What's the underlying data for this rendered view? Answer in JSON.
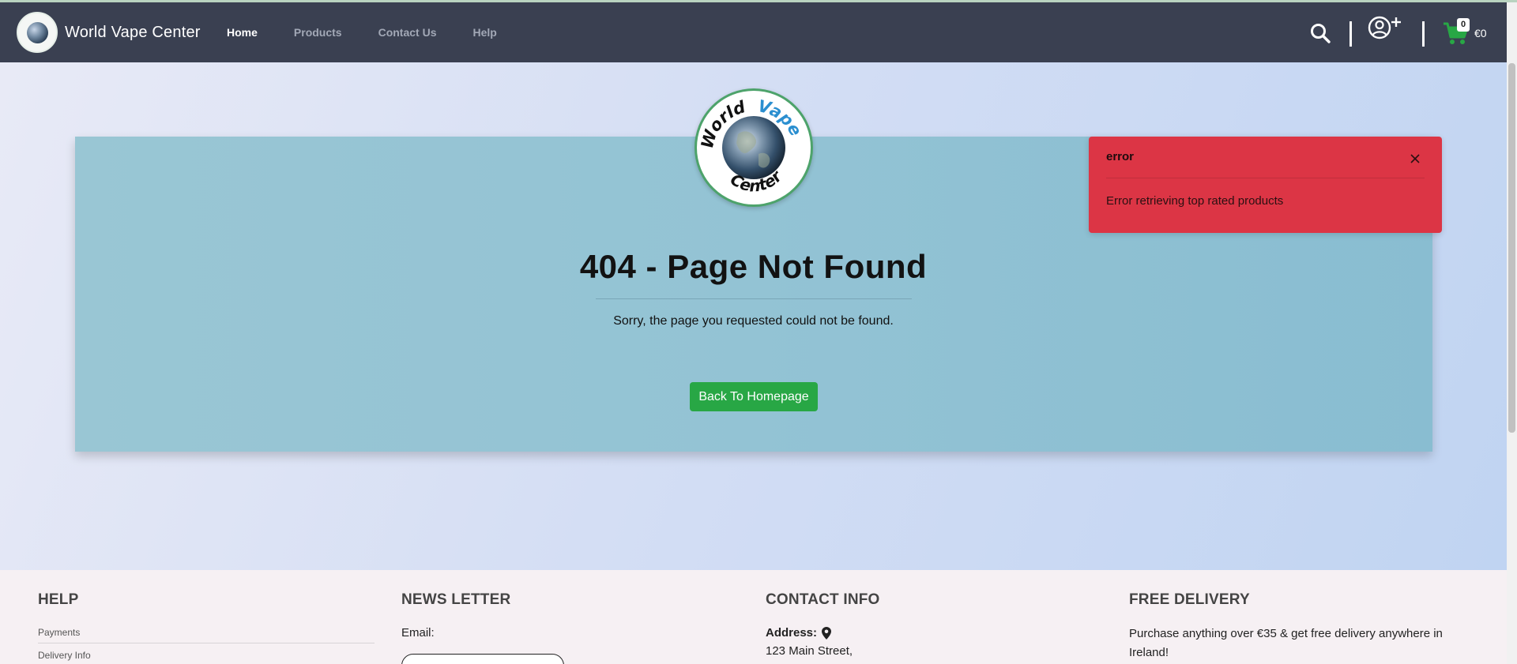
{
  "navbar": {
    "brand_name": "World Vape Center",
    "links": [
      {
        "label": "Home",
        "active": true
      },
      {
        "label": "Products",
        "active": false
      },
      {
        "label": "Contact Us",
        "active": false
      },
      {
        "label": "Help",
        "active": false
      }
    ],
    "cart_count": "0",
    "cart_total": "€0",
    "icons": [
      "search-icon",
      "user-add-icon",
      "cart-icon"
    ]
  },
  "logo": {
    "top_word_1": "World",
    "top_word_2": "Vape",
    "bottom_word": "Center"
  },
  "main": {
    "title": "404 - Page Not Found",
    "subtitle": "Sorry, the page you requested could not be found.",
    "button_label": "Back To Homepage"
  },
  "toast": {
    "title": "error",
    "message": "Error retrieving top rated products"
  },
  "footer": {
    "help": {
      "heading": "HELP",
      "links": [
        "Payments",
        "Delivery Info"
      ]
    },
    "newsletter": {
      "heading": "NEWS LETTER",
      "email_label": "Email:"
    },
    "contact": {
      "heading": "CONTACT INFO",
      "address_label": "Address:",
      "street": "123 Main Street,"
    },
    "delivery": {
      "heading": "FREE DELIVERY",
      "text": "Purchase anything over €35 & get free delivery anywhere in Ireland!"
    }
  },
  "colors": {
    "navbar_bg": "#3a4051",
    "card_bg": "#93c3d4",
    "button_green": "#28a745",
    "toast_red": "#dc3545",
    "footer_bg": "#f6f0f3"
  }
}
